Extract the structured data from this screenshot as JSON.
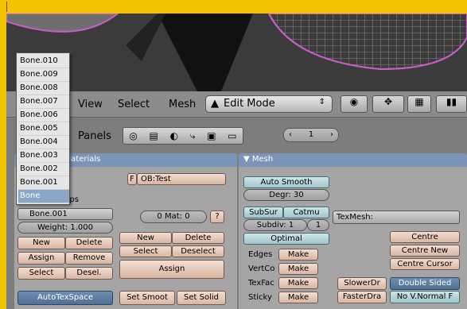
{
  "viewport_header": {
    "menu": [
      "View",
      "Select",
      "Mesh"
    ],
    "mode": "Edit Mode",
    "panels_label": "Panels",
    "frame_number": "1"
  },
  "bone_menu": [
    "Bone.010",
    "Bone.009",
    "Bone.008",
    "Bone.007",
    "Bone.006",
    "Bone.005",
    "Bone.004",
    "Bone.003",
    "Bone.002",
    "Bone.001",
    "Bone"
  ],
  "link_panel": {
    "title": "Link and Materials",
    "ob_field": "OB:Test",
    "f_label": "F",
    "groups_label": "Vertex Groups",
    "group_value": "Bone.001",
    "weight": "Weight: 1.000",
    "vg_buttons": [
      "New",
      "Delete",
      "Assign",
      "Remove",
      "Select",
      "Desel."
    ],
    "mat_counter": "0 Mat: 0",
    "mat_q": "?",
    "mat_buttons": [
      "New",
      "Delete",
      "Select",
      "Deselect"
    ],
    "assign": "Assign",
    "autotex": "AutoTexSpace",
    "set_smooth": "Set Smoot",
    "set_solid": "Set Solid"
  },
  "mesh_panel": {
    "title": "Mesh",
    "auto_smooth": "Auto Smooth",
    "degr": "Degr: 30",
    "subsurf": "SubSur",
    "catmull": "Catmu",
    "subdiv": "Subdiv: 1",
    "subdiv_r": "1",
    "optimal": "Optimal",
    "texmesh": "TexMesh:",
    "rows": [
      {
        "label": "Edges",
        "btn": "Make"
      },
      {
        "label": "VertCo",
        "btn": "Make"
      },
      {
        "label": "TexFac",
        "btn": "Make"
      },
      {
        "label": "Sticky",
        "btn": "Make"
      }
    ],
    "centre": "Centre",
    "centre_new": "Centre New",
    "centre_cursor": "Centre Cursor",
    "slower_draw": "SlowerDr",
    "faster_draw": "FasterDra",
    "double_sided": "Double Sided",
    "no_v_normal": "No V.Normal F"
  }
}
